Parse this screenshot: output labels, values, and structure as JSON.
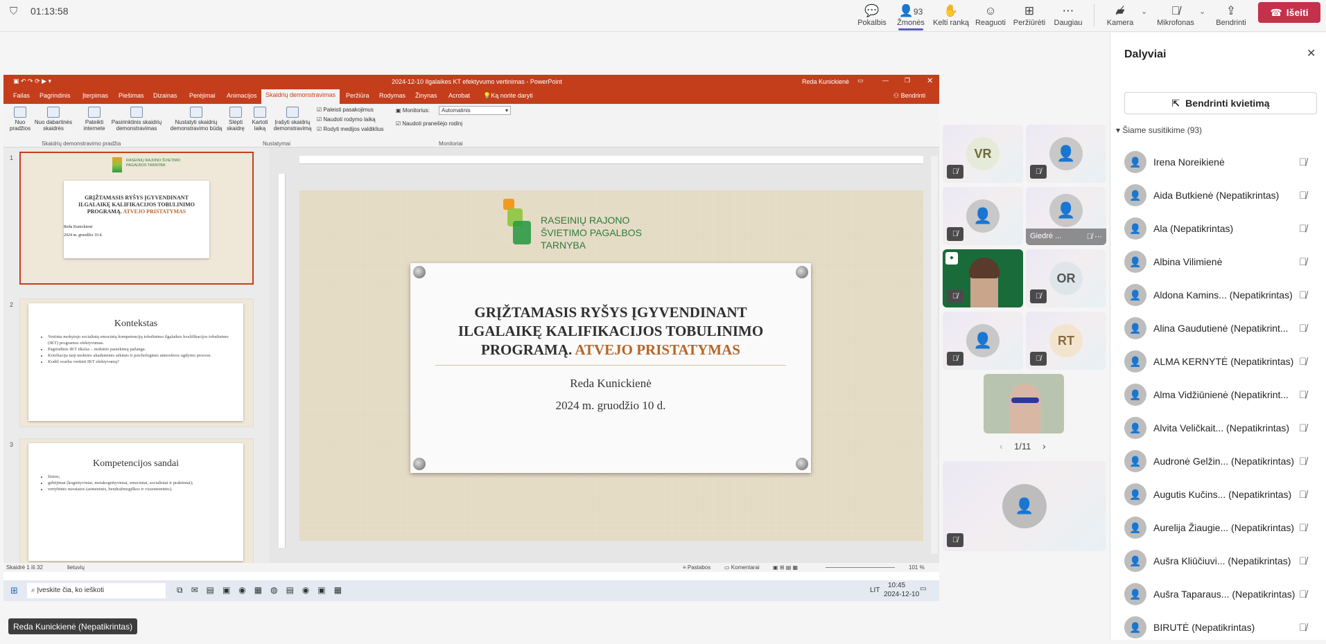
{
  "meeting": {
    "timer": "01:13:58"
  },
  "toolbar": {
    "chat": "Pokalbis",
    "people": "Žmonės",
    "people_count": "93",
    "raise": "Kelti ranką",
    "react": "Reaguoti",
    "view": "Peržiūrėti",
    "more": "Daugiau",
    "camera": "Kamera",
    "mic": "Mikrofonas",
    "share": "Bendrinti",
    "leave": "Išeiti"
  },
  "ppt": {
    "title": "2024-12-10 Ilgalaikes KT efektyvumo vertinimas - PowerPoint",
    "user": "Reda Kunickienė",
    "tabs": [
      "Failas",
      "Pagrindinis",
      "Įterpimas",
      "Piešimas",
      "Dizainas",
      "Perėjimai",
      "Animacijos",
      "Skaidrių demonstravimas",
      "Peržiūra",
      "Rodymas",
      "Žinynas",
      "Acrobat"
    ],
    "tellme": "Ką norite daryti",
    "share_btn": "Bendrinti",
    "ribbon": {
      "from_start": "Nuo pradžios",
      "from_current": "Nuo dabartinės skaidrės",
      "online": "Pateikti internete",
      "custom": "Pasirinktinis skaidrių demonstravimas",
      "setup": "Nustatyti skaidrių demonstravimo būdą",
      "hide": "Slėpti skaidrę",
      "rehearse": "Kartoti laiką",
      "record": "Įrašyti skaidrių demonstravimą",
      "cb1": "Paleisti pasakojimus",
      "cb2": "Naudoti rodymo laiką",
      "cb3": "Rodyti medijos valdiklius",
      "monitor_label": "Monitorius:",
      "monitor_value": "Automatinis",
      "presenter": "Naudoti pranešėjo rodinį",
      "grp1": "Skaidrių demonstravimo pradžia",
      "grp2": "Nustatymai",
      "grp3": "Monitoriai"
    },
    "slides": [
      {
        "num": "1",
        "org": "RASEINIŲ RAJONO ŠVIETIMO PAGALBOS TARNYBA",
        "title": "GRĮŽTAMASIS RYŠYS ĮGYVENDINANT ILGALAIKĘ KALIFIKACIJOS TOBULINIMO PROGRAMĄ.",
        "accent": "ATVEJO PRISTATYMAS",
        "author": "Reda Kunickienė",
        "date": "2024 m. gruodžio 10 d."
      },
      {
        "num": "2",
        "title": "Kontekstas",
        "bullets": [
          "Vertinta mokytojo socialinių emocinių kompetencijų tobulinimo ilgalaikės kvalifikacijos tobulinimo (IKT) programos efektyvumas.",
          "Pagrindinis IKT tikslas – mokinio pasiekimų pažanga.",
          "Koreliacija tarp mokinio akademinės sėkmės ir psichologinės atmosferos ugdymo procese.",
          "Kodėl svarbu vertinti IKT efektyvumą?"
        ]
      },
      {
        "num": "3",
        "title": "Kompetencijos sandai",
        "bullets": [
          "žinios;",
          "gebėjimai (kognityviniai, metakognityviniai, emociniai, socialiniai ir praktiniai);",
          "vertybinės nuostatos (asmeninės, bendražmogiškos ir visuomeninės)."
        ]
      }
    ],
    "main": {
      "org_line1": "RASEINIŲ RAJONO",
      "org_line2": "ŠVIETIMO PAGALBOS",
      "org_line3": "TARNYBA",
      "title1": "GRĮŽTAMASIS RYŠYS ĮGYVENDINANT",
      "title2": "ILGALAIKĘ KALIFIKACIJOS TOBULINIMO",
      "title3": "PROGRAMĄ.",
      "accent": "ATVEJO PRISTATYMAS",
      "author": "Reda Kunickienė",
      "date": "2024 m. gruodžio 10 d."
    },
    "status": {
      "slide": "Skaidrė 1 iš 32",
      "lang": "lietuvių",
      "notes": "Pastabos",
      "comments": "Komentarai",
      "zoom": "101 %"
    },
    "taskbar": {
      "search": "Įveskite čia, ko ieškoti",
      "lang": "LIT",
      "time": "10:45",
      "date": "2024-12-10"
    }
  },
  "grid": {
    "tiles": [
      {
        "initials": "VR",
        "color": "#e6ead8",
        "text": "#6a6a3a"
      },
      {
        "initials": "OR",
        "color": "#dfe6ea",
        "text": "#555"
      },
      {
        "initials": "RT",
        "color": "#f3e4cf",
        "text": "#8a6a3a"
      }
    ],
    "giedre": "Giedrė ...",
    "pager": "1/11"
  },
  "panel": {
    "title": "Dalyviai",
    "invite": "Bendrinti kvietimą",
    "section": "Šiame susitikime (93)",
    "people": [
      "Irena Noreikienė",
      "Aida Butkienė (Nepatikrintas)",
      "Ala (Nepatikrintas)",
      "Albina Vilimienė",
      "Aldona Kamins... (Nepatikrintas)",
      "Alina Gaudutienė (Nepatikrint...",
      "ALMA KERNYTĖ (Nepatikrintas)",
      "Alma Vidžiūnienė (Nepatikrint...",
      "Alvita Veličkait... (Nepatikrintas)",
      "Audronė Gelžin... (Nepatikrintas)",
      "Augutis Kučins... (Nepatikrintas)",
      "Aurelija Žiaugie... (Nepatikrintas)",
      "Aušra Kliūčiuvi... (Nepatikrintas)",
      "Aušra Taparaus... (Nepatikrintas)",
      "BIRUTĖ (Nepatikrintas)"
    ]
  },
  "presenter_chip": "Reda Kunickienė (Nepatikrintas)"
}
